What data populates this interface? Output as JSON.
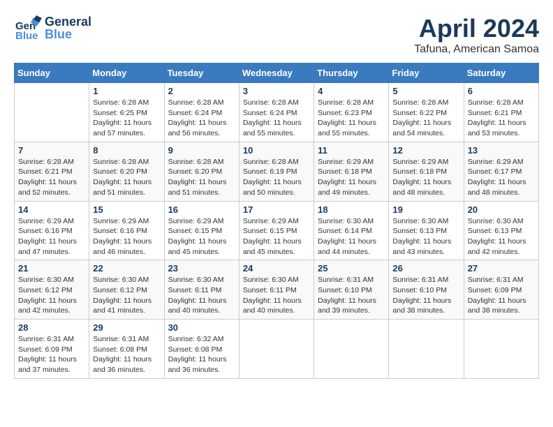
{
  "header": {
    "logo_general": "General",
    "logo_blue": "Blue",
    "month": "April 2024",
    "location": "Tafuna, American Samoa"
  },
  "weekdays": [
    "Sunday",
    "Monday",
    "Tuesday",
    "Wednesday",
    "Thursday",
    "Friday",
    "Saturday"
  ],
  "weeks": [
    [
      {
        "day": "",
        "info": ""
      },
      {
        "day": "1",
        "info": "Sunrise: 6:28 AM\nSunset: 6:25 PM\nDaylight: 11 hours\nand 57 minutes."
      },
      {
        "day": "2",
        "info": "Sunrise: 6:28 AM\nSunset: 6:24 PM\nDaylight: 11 hours\nand 56 minutes."
      },
      {
        "day": "3",
        "info": "Sunrise: 6:28 AM\nSunset: 6:24 PM\nDaylight: 11 hours\nand 55 minutes."
      },
      {
        "day": "4",
        "info": "Sunrise: 6:28 AM\nSunset: 6:23 PM\nDaylight: 11 hours\nand 55 minutes."
      },
      {
        "day": "5",
        "info": "Sunrise: 6:28 AM\nSunset: 6:22 PM\nDaylight: 11 hours\nand 54 minutes."
      },
      {
        "day": "6",
        "info": "Sunrise: 6:28 AM\nSunset: 6:21 PM\nDaylight: 11 hours\nand 53 minutes."
      }
    ],
    [
      {
        "day": "7",
        "info": "Sunrise: 6:28 AM\nSunset: 6:21 PM\nDaylight: 11 hours\nand 52 minutes."
      },
      {
        "day": "8",
        "info": "Sunrise: 6:28 AM\nSunset: 6:20 PM\nDaylight: 11 hours\nand 51 minutes."
      },
      {
        "day": "9",
        "info": "Sunrise: 6:28 AM\nSunset: 6:20 PM\nDaylight: 11 hours\nand 51 minutes."
      },
      {
        "day": "10",
        "info": "Sunrise: 6:28 AM\nSunset: 6:19 PM\nDaylight: 11 hours\nand 50 minutes."
      },
      {
        "day": "11",
        "info": "Sunrise: 6:29 AM\nSunset: 6:18 PM\nDaylight: 11 hours\nand 49 minutes."
      },
      {
        "day": "12",
        "info": "Sunrise: 6:29 AM\nSunset: 6:18 PM\nDaylight: 11 hours\nand 48 minutes."
      },
      {
        "day": "13",
        "info": "Sunrise: 6:29 AM\nSunset: 6:17 PM\nDaylight: 11 hours\nand 48 minutes."
      }
    ],
    [
      {
        "day": "14",
        "info": "Sunrise: 6:29 AM\nSunset: 6:16 PM\nDaylight: 11 hours\nand 47 minutes."
      },
      {
        "day": "15",
        "info": "Sunrise: 6:29 AM\nSunset: 6:16 PM\nDaylight: 11 hours\nand 46 minutes."
      },
      {
        "day": "16",
        "info": "Sunrise: 6:29 AM\nSunset: 6:15 PM\nDaylight: 11 hours\nand 45 minutes."
      },
      {
        "day": "17",
        "info": "Sunrise: 6:29 AM\nSunset: 6:15 PM\nDaylight: 11 hours\nand 45 minutes."
      },
      {
        "day": "18",
        "info": "Sunrise: 6:30 AM\nSunset: 6:14 PM\nDaylight: 11 hours\nand 44 minutes."
      },
      {
        "day": "19",
        "info": "Sunrise: 6:30 AM\nSunset: 6:13 PM\nDaylight: 11 hours\nand 43 minutes."
      },
      {
        "day": "20",
        "info": "Sunrise: 6:30 AM\nSunset: 6:13 PM\nDaylight: 11 hours\nand 42 minutes."
      }
    ],
    [
      {
        "day": "21",
        "info": "Sunrise: 6:30 AM\nSunset: 6:12 PM\nDaylight: 11 hours\nand 42 minutes."
      },
      {
        "day": "22",
        "info": "Sunrise: 6:30 AM\nSunset: 6:12 PM\nDaylight: 11 hours\nand 41 minutes."
      },
      {
        "day": "23",
        "info": "Sunrise: 6:30 AM\nSunset: 6:11 PM\nDaylight: 11 hours\nand 40 minutes."
      },
      {
        "day": "24",
        "info": "Sunrise: 6:30 AM\nSunset: 6:11 PM\nDaylight: 11 hours\nand 40 minutes."
      },
      {
        "day": "25",
        "info": "Sunrise: 6:31 AM\nSunset: 6:10 PM\nDaylight: 11 hours\nand 39 minutes."
      },
      {
        "day": "26",
        "info": "Sunrise: 6:31 AM\nSunset: 6:10 PM\nDaylight: 11 hours\nand 38 minutes."
      },
      {
        "day": "27",
        "info": "Sunrise: 6:31 AM\nSunset: 6:09 PM\nDaylight: 11 hours\nand 38 minutes."
      }
    ],
    [
      {
        "day": "28",
        "info": "Sunrise: 6:31 AM\nSunset: 6:09 PM\nDaylight: 11 hours\nand 37 minutes."
      },
      {
        "day": "29",
        "info": "Sunrise: 6:31 AM\nSunset: 6:08 PM\nDaylight: 11 hours\nand 36 minutes."
      },
      {
        "day": "30",
        "info": "Sunrise: 6:32 AM\nSunset: 6:08 PM\nDaylight: 11 hours\nand 36 minutes."
      },
      {
        "day": "",
        "info": ""
      },
      {
        "day": "",
        "info": ""
      },
      {
        "day": "",
        "info": ""
      },
      {
        "day": "",
        "info": ""
      }
    ]
  ]
}
